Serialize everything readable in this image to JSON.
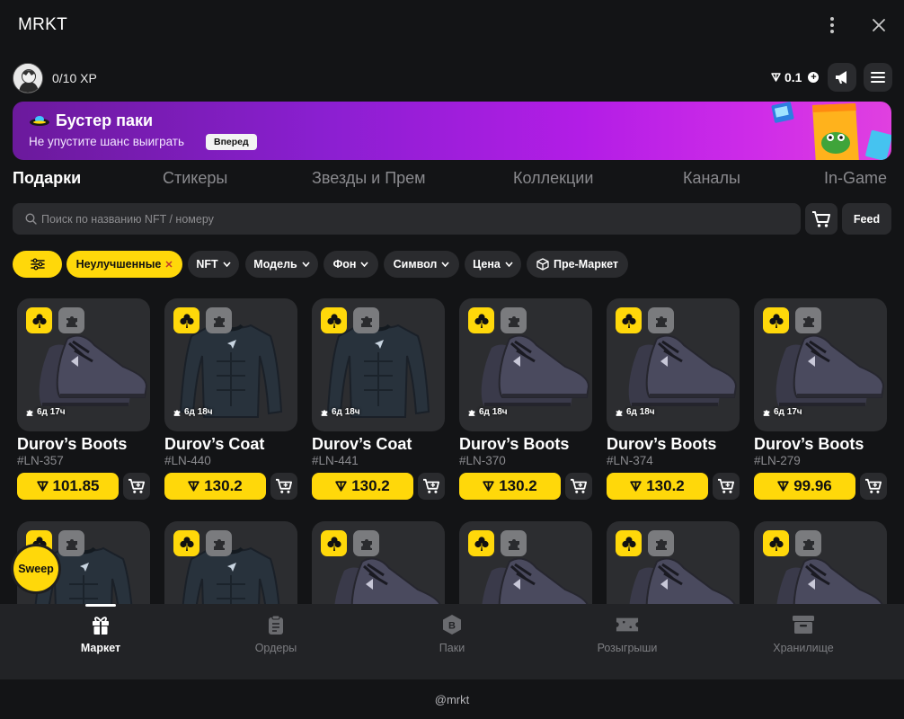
{
  "app": {
    "title": "MRKT"
  },
  "user": {
    "xp": "0/10 XP",
    "balance": "0.1"
  },
  "banner": {
    "title": "Бустер паки",
    "subtitle": "Не упустите шанс выиграть",
    "button": "Вперед"
  },
  "tabs": [
    "Подарки",
    "Стикеры",
    "Звезды и Прем",
    "Коллекции",
    "Каналы",
    "In-Game"
  ],
  "search": {
    "placeholder": "Поиск по названию NFT / номеру",
    "feed_label": "Feed"
  },
  "filters": {
    "active": "Неулучшенные",
    "dropdowns": [
      "NFT",
      "Модель",
      "Фон",
      "Символ",
      "Цена"
    ],
    "premarket": "Пре-Маркет"
  },
  "cards": [
    {
      "name": "Durov’s Boots",
      "id": "#LN-357",
      "price": "101.85",
      "timer": "6д 17ч",
      "kind": "boots"
    },
    {
      "name": "Durov’s Coat",
      "id": "#LN-440",
      "price": "130.2",
      "timer": "6д 18ч",
      "kind": "coat"
    },
    {
      "name": "Durov’s Coat",
      "id": "#LN-441",
      "price": "130.2",
      "timer": "6д 18ч",
      "kind": "coat"
    },
    {
      "name": "Durov’s Boots",
      "id": "#LN-370",
      "price": "130.2",
      "timer": "6д 18ч",
      "kind": "boots"
    },
    {
      "name": "Durov’s Boots",
      "id": "#LN-374",
      "price": "130.2",
      "timer": "6д 18ч",
      "kind": "boots"
    },
    {
      "name": "Durov’s Boots",
      "id": "#LN-279",
      "price": "99.96",
      "timer": "6д 17ч",
      "kind": "boots"
    },
    {
      "kind": "coat"
    },
    {
      "kind": "coat"
    },
    {
      "kind": "boots"
    },
    {
      "kind": "boots"
    },
    {
      "kind": "boots"
    },
    {
      "kind": "boots"
    }
  ],
  "sweep_label": "Sweep",
  "nav": [
    {
      "label": "Маркет",
      "icon": "gift-icon"
    },
    {
      "label": "Ордеры",
      "icon": "clipboard-icon"
    },
    {
      "label": "Паки",
      "icon": "pack-icon"
    },
    {
      "label": "Розыгрыши",
      "icon": "ticket-icon"
    },
    {
      "label": "Хранилище",
      "icon": "archive-icon"
    }
  ],
  "footer": "@mrkt"
}
